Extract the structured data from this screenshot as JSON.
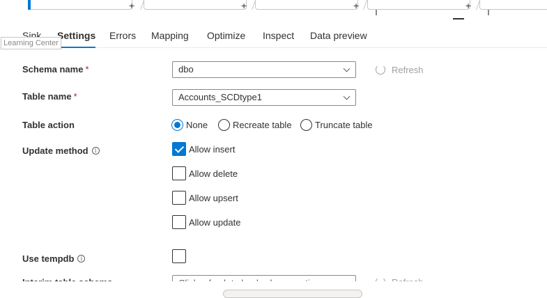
{
  "tabs": [
    {
      "label": "Sink"
    },
    {
      "label": "Settings"
    },
    {
      "label": "Errors"
    },
    {
      "label": "Mapping"
    },
    {
      "label": "Optimize"
    },
    {
      "label": "Inspect"
    },
    {
      "label": "Data preview"
    }
  ],
  "tooltip": "Learning Center",
  "form": {
    "schema_name": {
      "label": "Schema name",
      "required_mark": "*",
      "value": "dbo",
      "refresh": "Refresh"
    },
    "table_name": {
      "label": "Table name",
      "required_mark": "*",
      "value": "Accounts_SCDtype1"
    },
    "table_action": {
      "label": "Table action",
      "options": [
        "None",
        "Recreate table",
        "Truncate table"
      ],
      "selected": "None"
    },
    "update_method": {
      "label": "Update method",
      "options": [
        {
          "label": "Allow insert",
          "checked": true
        },
        {
          "label": "Allow delete",
          "checked": false
        },
        {
          "label": "Allow upsert",
          "checked": false
        },
        {
          "label": "Allow update",
          "checked": false
        }
      ]
    },
    "use_tempdb": {
      "label": "Use tempdb",
      "checked": false
    },
    "interim_table_schema": {
      "label": "Interim table schema",
      "placeholder": "Click refresh to load schema options",
      "refresh": "Refresh"
    }
  },
  "canvas": {
    "plus_glyph": "+"
  },
  "colors": {
    "accent": "#0078d4",
    "required": "#a4262c",
    "disabled_text": "#a19f9d"
  },
  "icons": [
    "info-icon",
    "refresh-icon",
    "chevron-down-icon",
    "checkmark-icon"
  ]
}
